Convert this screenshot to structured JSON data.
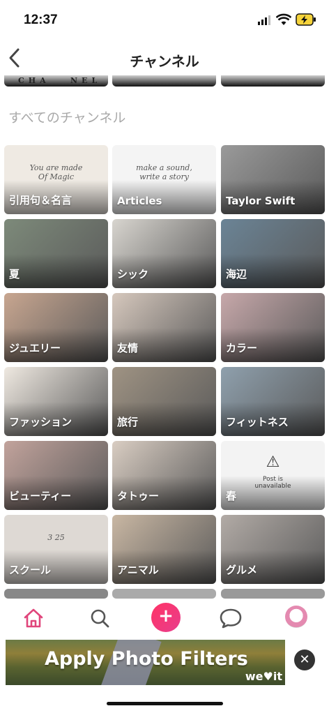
{
  "status": {
    "time": "12:37"
  },
  "nav": {
    "title": "チャンネル"
  },
  "top_strip": {
    "text_left": "CHA",
    "text_right": "NEL"
  },
  "section_title": "すべてのチャンネル",
  "channels": [
    {
      "label": "引用句＆名言",
      "bg": "#efeae3",
      "deco": "You are made\nOf Magic"
    },
    {
      "label": "Articles",
      "bg": "#f4f4f4",
      "deco": "make a sound,\nwrite a story"
    },
    {
      "label": "Taylor Swift",
      "bg": "#9a9a9a"
    },
    {
      "label": "夏",
      "bg": "#7d8a7a"
    },
    {
      "label": "シック",
      "bg": "#d8d5cf"
    },
    {
      "label": "海辺",
      "bg": "#6b8496"
    },
    {
      "label": "ジュエリー",
      "bg": "#c8a690"
    },
    {
      "label": "友情",
      "bg": "#d6c8bd"
    },
    {
      "label": "カラー",
      "bg": "#c7a8aa"
    },
    {
      "label": "ファッション",
      "bg": "#efe9e1"
    },
    {
      "label": "旅行",
      "bg": "#9f9383"
    },
    {
      "label": "フィットネス",
      "bg": "#8fa0ad"
    },
    {
      "label": "ビューティー",
      "bg": "#c2a39c"
    },
    {
      "label": "タトゥー",
      "bg": "#d9cdc2"
    },
    {
      "label": "春",
      "bg": "#f3f3f3",
      "unavailable": "Post is\nunavailable"
    },
    {
      "label": "スクール",
      "bg": "#ded9d4",
      "deco": "3 25"
    },
    {
      "label": "アニマル",
      "bg": "#c9b7a3"
    },
    {
      "label": "グルメ",
      "bg": "#b2aba6"
    }
  ],
  "ad": {
    "text": "Apply Photo Filters",
    "brand": "we♥it"
  },
  "colors": {
    "accent": "#e83e8c",
    "tab_icon": "#555555",
    "home_icon": "#e0457b"
  }
}
